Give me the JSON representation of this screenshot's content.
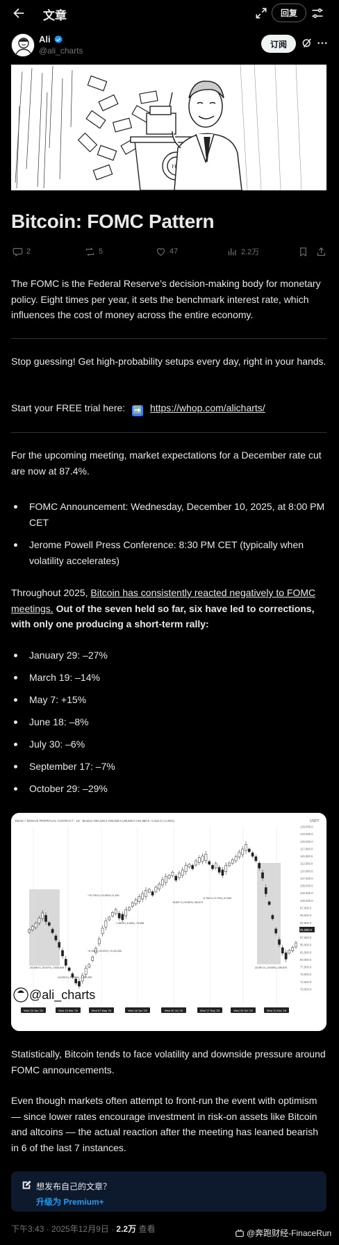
{
  "header": {
    "title": "文章",
    "reply_label": "回复"
  },
  "author": {
    "name": "Ali",
    "handle": "@ali_charts",
    "subscribe_label": "订阅"
  },
  "article": {
    "title": "Bitcoin: FOMC Pattern",
    "stats": {
      "replies": "2",
      "reposts": "5",
      "likes": "47",
      "views": "2.2万"
    },
    "intro": "The FOMC is the Federal Reserve’s decision-making body for monetary policy. Eight times per year, it sets the benchmark interest rate, which influences the cost of money across the entire economy.",
    "promo_text": "Stop guessing! Get high-probability setups every day, right in your hands.",
    "trial_prefix": "Start your FREE trial here:",
    "trial_emoji": "➡️",
    "trial_link": "https://whop.com/alicharts/",
    "expectation": "For the upcoming meeting, market expectations for a December rate cut are now at 87.4%.",
    "schedule": [
      "FOMC Announcement: Wednesday, December 10, 2025, at 8:00 PM CET",
      "Jerome Powell Press Conference: 8:30 PM CET (typically when volatility accelerates)"
    ],
    "history_prefix": "Throughout 2025,",
    "history_link": "Bitcoin has consistently reacted negatively to FOMC meetings.",
    "history_bold": "Out of the seven held so far, six have led to corrections, with only one producing a short-term rally:",
    "reactions": [
      "January 29: –27%",
      "March 19: –14%",
      "May 7: +15%",
      "June 18: –8%",
      "July 30: –6%",
      "September 17: –7%",
      "October 29: –29%"
    ],
    "stat_para": "Statistically, Bitcoin tends to face volatility and downside pressure around FOMC announcements.",
    "closing": "Even though markets often attempt to front-run the event with optimism — since lower rates encourage investment in risk-on assets like Bitcoin and altcoins — the actual reaction after the meeting has leaned bearish in 6 of the last 7 instances."
  },
  "chart_image": {
    "header_text": "Bitcoin / TetherUS PERPETUAL CONTRACT · 1D · Binance  O90,348.4  H93,800.0  L89,600.0  C91,880.0  +1,531.6 (+1.69%)",
    "currency": "USDT",
    "watermark_handle": "@ali_charts",
    "price_ticks": [
      "125,000.0",
      "122,500.0",
      "120,000.0",
      "117,500.0",
      "115,000.0",
      "112,500.0",
      "110,000.0",
      "107,500.0",
      "105,000.0",
      "102,500.0",
      "100,000.0",
      "97,500.0",
      "95,000.0",
      "92,500.0",
      "90,000.0",
      "87,500.0",
      "85,000.0",
      "82,500.0",
      "80,000.0",
      "77,500.0",
      "75,000.0",
      "72,500.0",
      "70,000.0"
    ],
    "current_price": "91,880.0",
    "date_labels": [
      "Wed 29 Jan '25",
      "Wed 19 Mar '25",
      "Wed 07 May '25",
      "Wed 18 Jun '25",
      "Wed 30 Jul '25",
      "Wed 17 Sep '25",
      "Wed 29 Oct '25",
      "Wed 10 Dec '25"
    ],
    "measurements": [
      "-28,368.5 (-26.67%) -2,836,849",
      "-14,025.5 (-13.91%) -1,400,255",
      "+5,150.0 (+6.02%) +3,102,000",
      "+75,728.5 (+13.56%) 11,400",
      "-7,369.8 (-6.26%) -73,698",
      "+8,697.4 (+6.56%) +86,974",
      "-6,760.9 (-5.72%) -67,609",
      "-33,987.5 (-29.65%) -339,875"
    ]
  },
  "premium": {
    "question": "想发布自己的文章？",
    "upgrade": "升级为 Premium+"
  },
  "meta": {
    "time": "下午3:43 · 2025年12月9日 ·",
    "views": "2.2万",
    "views_suffix": "查看"
  },
  "watermark": "@奔跑财经-FinaceRun"
}
